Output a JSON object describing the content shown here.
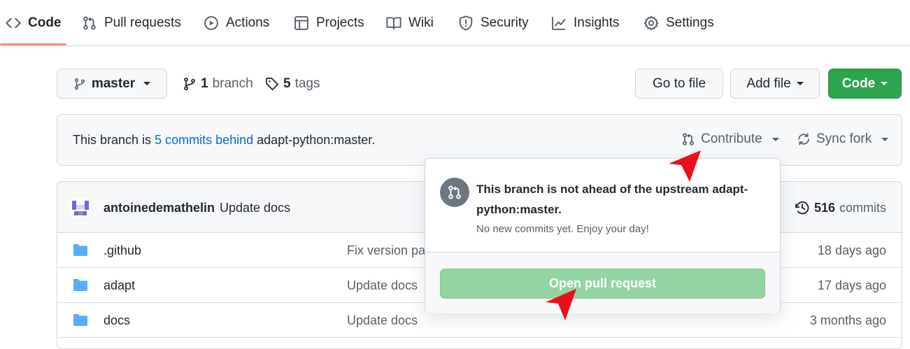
{
  "nav": {
    "tabs": [
      {
        "label": "Code",
        "icon": "code-icon",
        "active": true
      },
      {
        "label": "Pull requests",
        "icon": "git-pull-request-icon"
      },
      {
        "label": "Actions",
        "icon": "play-icon"
      },
      {
        "label": "Projects",
        "icon": "table-icon"
      },
      {
        "label": "Wiki",
        "icon": "book-icon"
      },
      {
        "label": "Security",
        "icon": "shield-icon"
      },
      {
        "label": "Insights",
        "icon": "graph-icon"
      },
      {
        "label": "Settings",
        "icon": "gear-icon"
      }
    ]
  },
  "toolbar": {
    "branch_name": "master",
    "branch_count": "1",
    "branch_word": "branch",
    "tag_count": "5",
    "tag_word": "tags",
    "go_to_file": "Go to file",
    "add_file": "Add file",
    "code": "Code"
  },
  "fork_status": {
    "prefix": "This branch is",
    "behind_link": "5 commits behind",
    "upstream": "adapt-python:master.",
    "contribute": "Contribute",
    "sync_fork": "Sync fork"
  },
  "latest_commit": {
    "author": "antoinedemathelin",
    "message": "Update docs",
    "commit_count": "516",
    "commit_word": "commits"
  },
  "files": [
    {
      "name": ".github",
      "message": "Fix version pa",
      "age": "18 days ago"
    },
    {
      "name": "adapt",
      "message": "Update docs",
      "age": "17 days ago"
    },
    {
      "name": "docs",
      "message": "Update docs",
      "age": "3 months ago"
    }
  ],
  "popover": {
    "title": "This branch is not ahead of the upstream adapt-python:master.",
    "subtitle": "No new commits yet. Enjoy your day!",
    "button": "Open pull request"
  },
  "colors": {
    "primary_green": "#2da44e",
    "disabled_green": "#94d3a2",
    "link_blue": "#0969da",
    "folder_blue": "#54aeff",
    "annotation_red": "#e8101a",
    "tab_underline": "#fd8c73"
  }
}
